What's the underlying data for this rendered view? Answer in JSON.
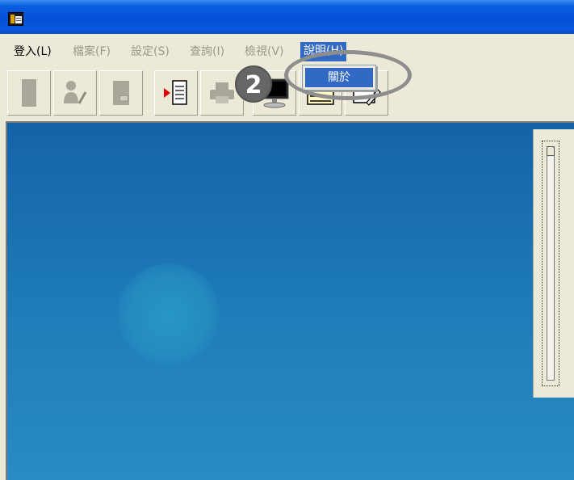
{
  "window": {
    "app_icon": "app-window-icon"
  },
  "menubar": {
    "items": [
      {
        "label": "登入(L)",
        "enabled": true
      },
      {
        "label": "檔案(F)",
        "enabled": false
      },
      {
        "label": "設定(S)",
        "enabled": false
      },
      {
        "label": "查詢(I)",
        "enabled": false
      },
      {
        "label": "檢視(V)",
        "enabled": false
      },
      {
        "label": "說明(H)",
        "enabled": true,
        "active": true
      }
    ]
  },
  "toolbar": {
    "buttons": [
      {
        "icon": "document-icon",
        "enabled": false
      },
      {
        "icon": "user-edit-icon",
        "enabled": false
      },
      {
        "icon": "page-icon",
        "enabled": false
      },
      {
        "icon": "play-document-icon",
        "enabled": true
      },
      {
        "icon": "printer-icon",
        "enabled": false
      },
      {
        "icon": "monitor-icon",
        "enabled": true
      },
      {
        "icon": "list-icon",
        "enabled": true
      },
      {
        "icon": "edit-icon",
        "enabled": true
      }
    ]
  },
  "help_menu": {
    "items": [
      {
        "label": "關於"
      }
    ]
  },
  "annotation": {
    "step_number": "2"
  },
  "colors": {
    "titlebar": "#0450d6",
    "menu_highlight": "#316ac5",
    "canvas_top": "#1463a8",
    "canvas_bottom": "#2a8cc4",
    "annotation_gray": "#8e8e8e"
  }
}
